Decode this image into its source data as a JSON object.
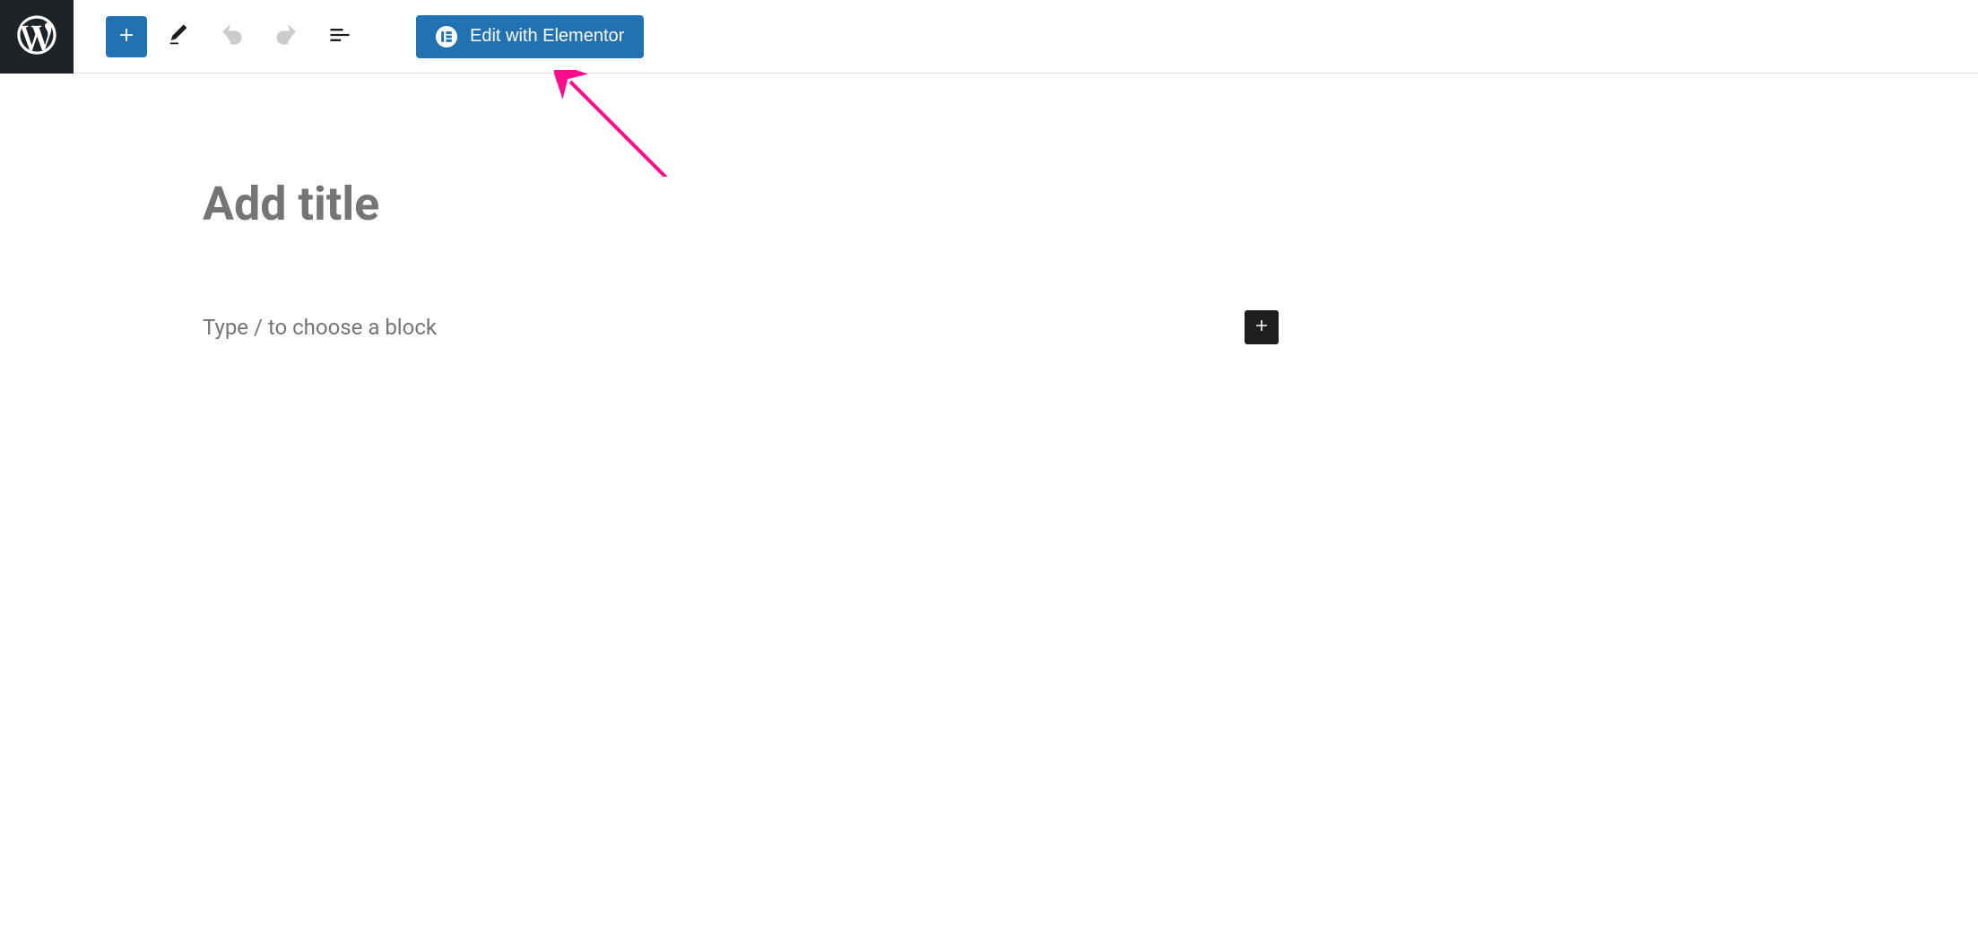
{
  "toolbar": {
    "elementor_button_label": "Edit with Elementor"
  },
  "editor": {
    "title_placeholder": "Add title",
    "block_placeholder": "Type / to choose a block"
  }
}
